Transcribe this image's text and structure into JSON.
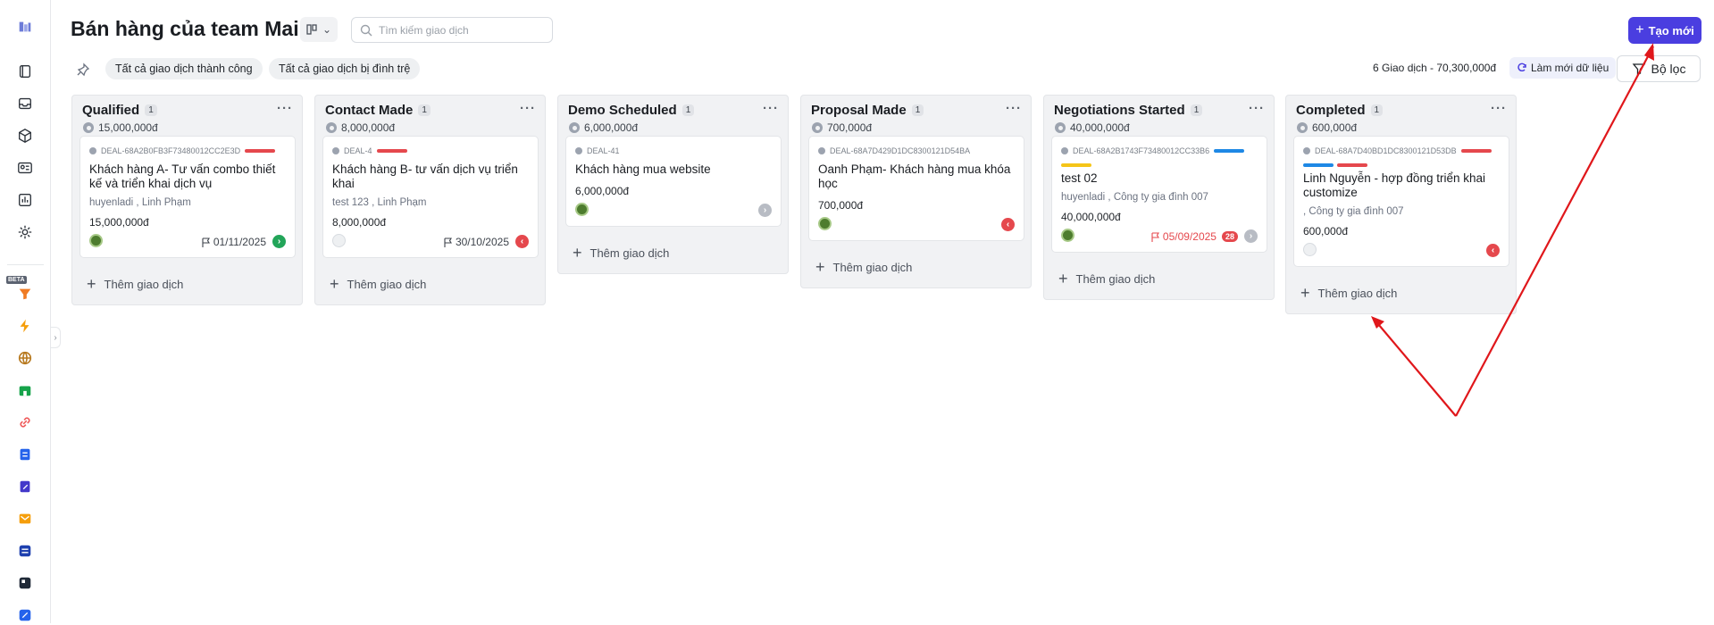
{
  "header": {
    "title": "Bán hàng của team Mai",
    "search_placeholder": "Tìm kiếm giao dịch",
    "create_label": "Tạo mới"
  },
  "toolbar": {
    "chips": [
      "Tất cả giao dịch thành công",
      "Tất cả giao dịch bị đình trệ"
    ],
    "summary": "6 Giao dịch - 70,300,000đ",
    "refresh_label": "Làm mới dữ liệu",
    "filter_label": "Bộ lọc"
  },
  "sidebar": {
    "beta_label": "BETA",
    "icons": [
      "book-icon",
      "inbox-icon",
      "box-icon",
      "contact-card-icon",
      "chart-icon",
      "settings-icon",
      "funnel-icon",
      "lightning-icon",
      "globe-icon",
      "store-icon",
      "link-icon",
      "document-icon",
      "edit-document-icon",
      "mail-template-icon",
      "shuffle-icon",
      "layout-icon",
      "pen-icon"
    ]
  },
  "columns": [
    {
      "name": "Qualified",
      "count": "1",
      "total": "15,000,000đ",
      "add_label": "Thêm giao dịch",
      "cards": [
        {
          "deal_id": "DEAL-68A2B0FB3F73480012CC2E3D",
          "title": "Khách hàng A- Tư vấn combo thiết kế và triển khai dịch vụ",
          "owner": "huyenladi , Linh Phạm",
          "amount": "15,000,000đ",
          "due": "01/11/2025",
          "due_color": "normal",
          "arrow": "›",
          "arrow_color": "#22a559",
          "id_tag_color": "#e5484d",
          "avatar": "filled"
        }
      ]
    },
    {
      "name": "Contact Made",
      "count": "1",
      "total": "8,000,000đ",
      "add_label": "Thêm giao dịch",
      "cards": [
        {
          "deal_id": "DEAL-4",
          "title": "Khách hàng B- tư vấn dịch vụ triển khai",
          "owner": "test 123 , Linh Phạm",
          "amount": "8,000,000đ",
          "due": "30/10/2025",
          "due_color": "normal",
          "arrow": "‹",
          "arrow_color": "#e5484d",
          "id_tag_color": "#e5484d",
          "avatar": "empty"
        }
      ]
    },
    {
      "name": "Demo Scheduled",
      "count": "1",
      "total": "6,000,000đ",
      "add_label": "Thêm giao dịch",
      "cards": [
        {
          "deal_id": "DEAL-41",
          "title": "Khách hàng mua website",
          "owner": "",
          "amount": "6,000,000đ",
          "due": "",
          "arrow": "›",
          "arrow_color": "#b8bcc4",
          "avatar": "filled"
        }
      ]
    },
    {
      "name": "Proposal Made",
      "count": "1",
      "total": "700,000đ",
      "add_label": "Thêm giao dịch",
      "cards": [
        {
          "deal_id": "DEAL-68A7D429D1DC8300121D54BA",
          "title": "Oanh Phạm- Khách hàng mua khóa học",
          "owner": "",
          "amount": "700,000đ",
          "due": "",
          "arrow": "‹",
          "arrow_color": "#e5484d",
          "avatar": "filled"
        }
      ]
    },
    {
      "name": "Negotiations Started",
      "count": "1",
      "total": "40,000,000đ",
      "add_label": "Thêm giao dịch",
      "cards": [
        {
          "deal_id": "DEAL-68A2B1743F73480012CC33B6",
          "title": "test 02",
          "owner": "huyenladi , Công ty gia đình 007",
          "amount": "40,000,000đ",
          "due": "05/09/2025",
          "due_color": "red",
          "overdue_days": "28",
          "arrow": "›",
          "arrow_color": "#b8bcc4",
          "id_tag_color": "#1e88e5",
          "tags": [
            "#f5c518"
          ],
          "avatar": "filled"
        }
      ]
    },
    {
      "name": "Completed",
      "count": "1",
      "total": "600,000đ",
      "add_label": "Thêm giao dịch",
      "cards": [
        {
          "deal_id": "DEAL-68A7D40BD1DC8300121D53DB",
          "title": "Linh Nguyễn - hợp đồng triển khai customize",
          "owner": ", Công ty gia đình 007",
          "amount": "600,000đ",
          "due": "",
          "arrow": "‹",
          "arrow_color": "#e5484d",
          "id_tag_color": "#e5484d",
          "tags": [
            "#1e88e5",
            "#e5484d"
          ],
          "avatar": "empty"
        }
      ]
    }
  ],
  "colors": {
    "accent": "#4a3ee0",
    "annotation_arrow": "#e0171b"
  }
}
